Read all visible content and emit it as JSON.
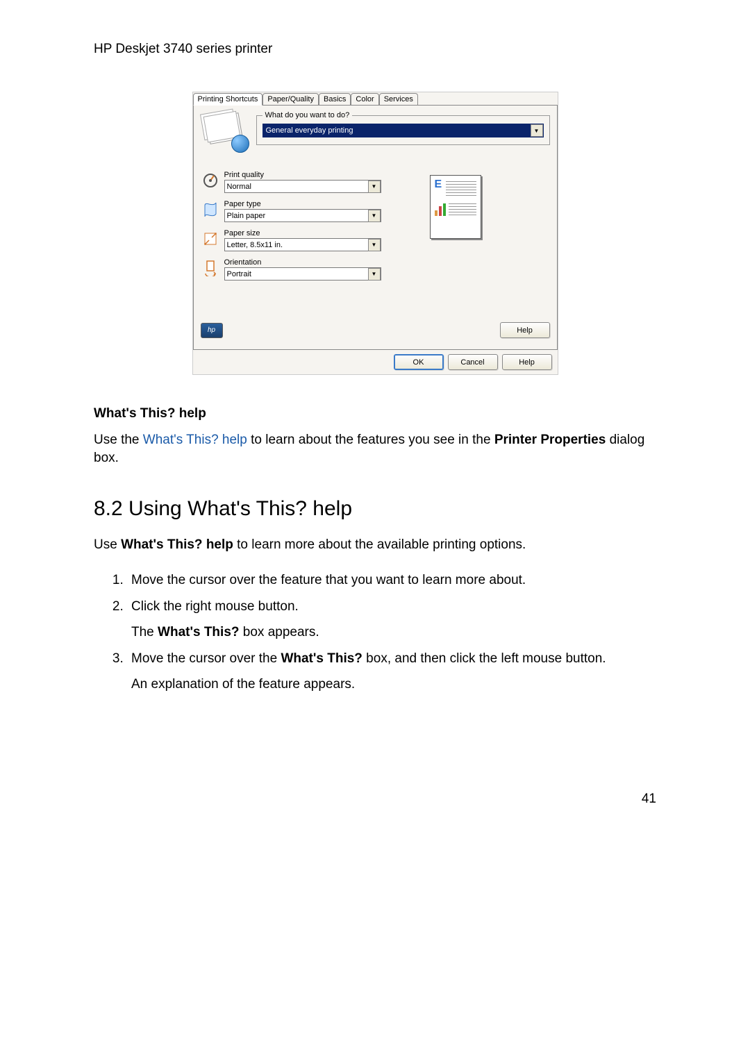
{
  "doc_header": "HP Deskjet 3740 series printer",
  "screenshot": {
    "tabs": [
      "Printing Shortcuts",
      "Paper/Quality",
      "Basics",
      "Color",
      "Services"
    ],
    "active_tab_index": 0,
    "fieldset_legend": "What do you want to do?",
    "task_select": "General everyday printing",
    "options": [
      {
        "label": "Print quality",
        "value": "Normal",
        "icon": "quality"
      },
      {
        "label": "Paper type",
        "value": "Plain paper",
        "icon": "papertype"
      },
      {
        "label": "Paper size",
        "value": "Letter, 8.5x11 in.",
        "icon": "papersize"
      },
      {
        "label": "Orientation",
        "value": "Portrait",
        "icon": "orientation"
      }
    ],
    "help_button": "Help",
    "footer": {
      "ok": "OK",
      "cancel": "Cancel",
      "help": "Help"
    },
    "hp_logo_text": "hp"
  },
  "body": {
    "sub1_title": "What's This? help",
    "sub1_p1_a": "Use the ",
    "sub1_p1_link": "What's This? help",
    "sub1_p1_b": " to learn about the features you see in the ",
    "sub1_p1_bold": "Printer Properties",
    "sub1_p1_c": " dialog box.",
    "section_title": "8.2  Using What's This? help",
    "intro_a": "Use ",
    "intro_bold": "What's This? help",
    "intro_b": " to learn more about the available printing options.",
    "steps": {
      "s1": "Move the cursor over the feature that you want to learn more about.",
      "s2": "Click the right mouse button.",
      "s2_sub_a": "The ",
      "s2_sub_bold": "What's This?",
      "s2_sub_b": " box appears.",
      "s3_a": "Move the cursor over the ",
      "s3_bold": "What's This?",
      "s3_b": " box, and then click the left mouse button.",
      "s3_sub": "An explanation of the feature appears."
    }
  },
  "page_number": "41"
}
